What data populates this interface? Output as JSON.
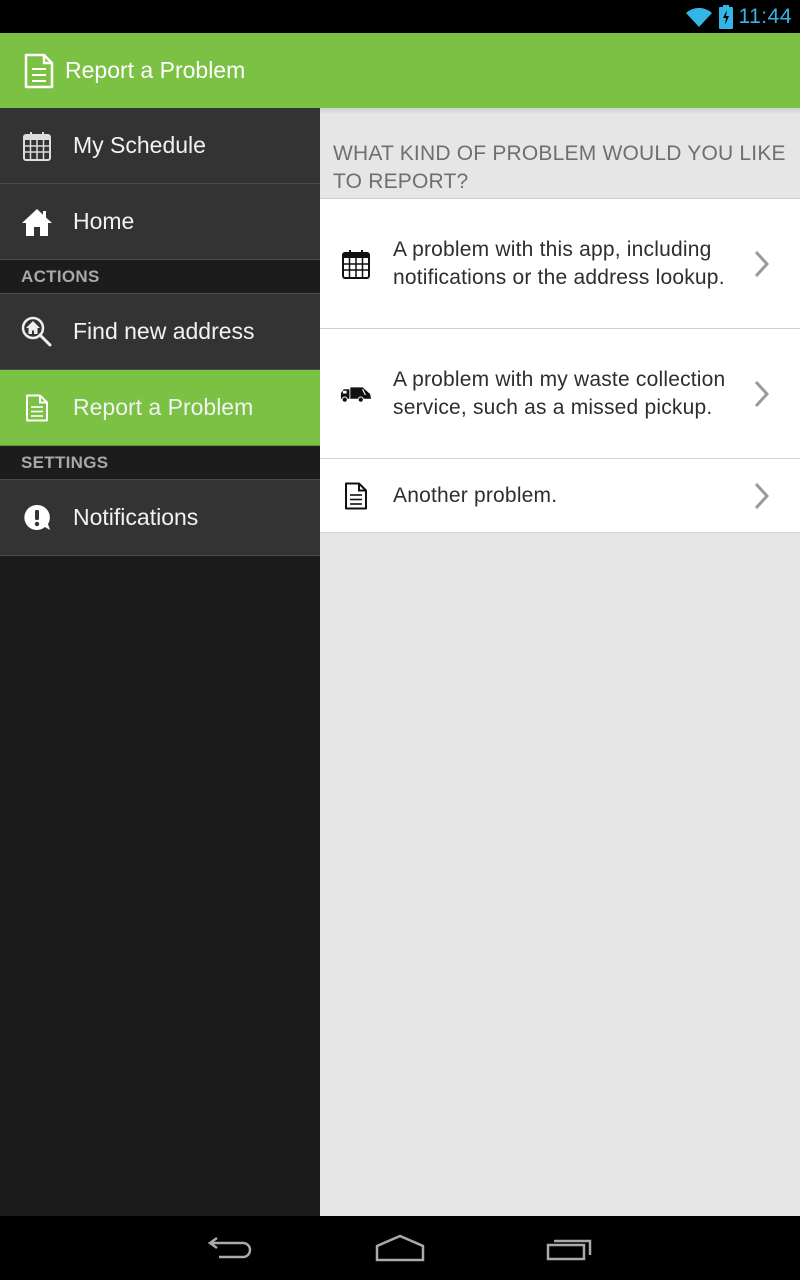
{
  "status_bar": {
    "time": "11:44",
    "icons": [
      "wifi-icon",
      "battery-charging-icon"
    ],
    "accent_color": "#33b5e5"
  },
  "action_bar": {
    "icon": "document-icon",
    "title": "Report a Problem",
    "color": "#7bc143"
  },
  "drawer": {
    "items_top": [
      {
        "icon": "calendar-icon",
        "label": "My Schedule"
      },
      {
        "icon": "home-icon",
        "label": "Home"
      }
    ],
    "sections": [
      {
        "title": "ACTIONS",
        "items": [
          {
            "icon": "search-home-icon",
            "label": "Find new address"
          },
          {
            "icon": "document-icon",
            "label": "Report a Problem",
            "active": true
          }
        ]
      },
      {
        "title": "SETTINGS",
        "items": [
          {
            "icon": "alert-bubble-icon",
            "label": "Notifications"
          }
        ]
      }
    ]
  },
  "content": {
    "header": "WHAT KIND OF PROBLEM WOULD YOU LIKE TO REPORT?",
    "problems": [
      {
        "icon": "calendar-icon",
        "text": "A problem with this app, including notifications or the address lookup."
      },
      {
        "icon": "garbage-truck-icon",
        "text": "A problem with my waste collection service, such as a missed pickup."
      },
      {
        "icon": "document-icon",
        "text": "Another problem."
      }
    ]
  },
  "nav_bar": {
    "buttons": [
      "back-icon",
      "home-icon",
      "recent-apps-icon"
    ]
  }
}
